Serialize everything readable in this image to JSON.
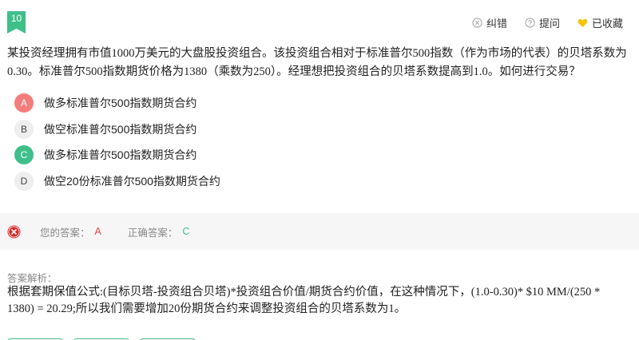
{
  "question": {
    "number": "10",
    "text": "某投资经理拥有市值1000万美元的大盘股投资组合。该投资组合相对于标准普尔500指数（作为市场的代表）的贝塔系数为0.30。标准普尔500指数期货价格为1380（乘数为250）。经理想把投资组合的贝塔系数提高到1.0。如何进行交易？"
  },
  "actions": {
    "correct_label": "纠错",
    "ask_label": "提问",
    "favorite_label": "已收藏"
  },
  "options": [
    {
      "letter": "A",
      "text": "做多标准普尔500指数期货合约",
      "state": "wrong"
    },
    {
      "letter": "B",
      "text": "做空标准普尔500指数期货合约",
      "state": "normal"
    },
    {
      "letter": "C",
      "text": "做多标准普尔500指数期货合约",
      "state": "right"
    },
    {
      "letter": "D",
      "text": "做空20份标准普尔500指数期货合约",
      "state": "normal"
    }
  ],
  "answer": {
    "your_label": "您的答案：",
    "your_value": "A",
    "correct_label": "正确答案：",
    "correct_value": "C"
  },
  "analysis": {
    "title": "答案解析：",
    "text": "根据套期保值公式:(目标贝塔-投资组合贝塔)*投资组合价值/期货合约价值，在这种情况下，(1.0-0.30)* $10 MM/(250 * 1380) = 20.29;所以我们需要增加20份期货合约来调整投资组合的贝塔系数为1。"
  },
  "colors": {
    "accent": "#3fbf8a",
    "wrong": "#e04848",
    "favorite": "#f5c400"
  }
}
